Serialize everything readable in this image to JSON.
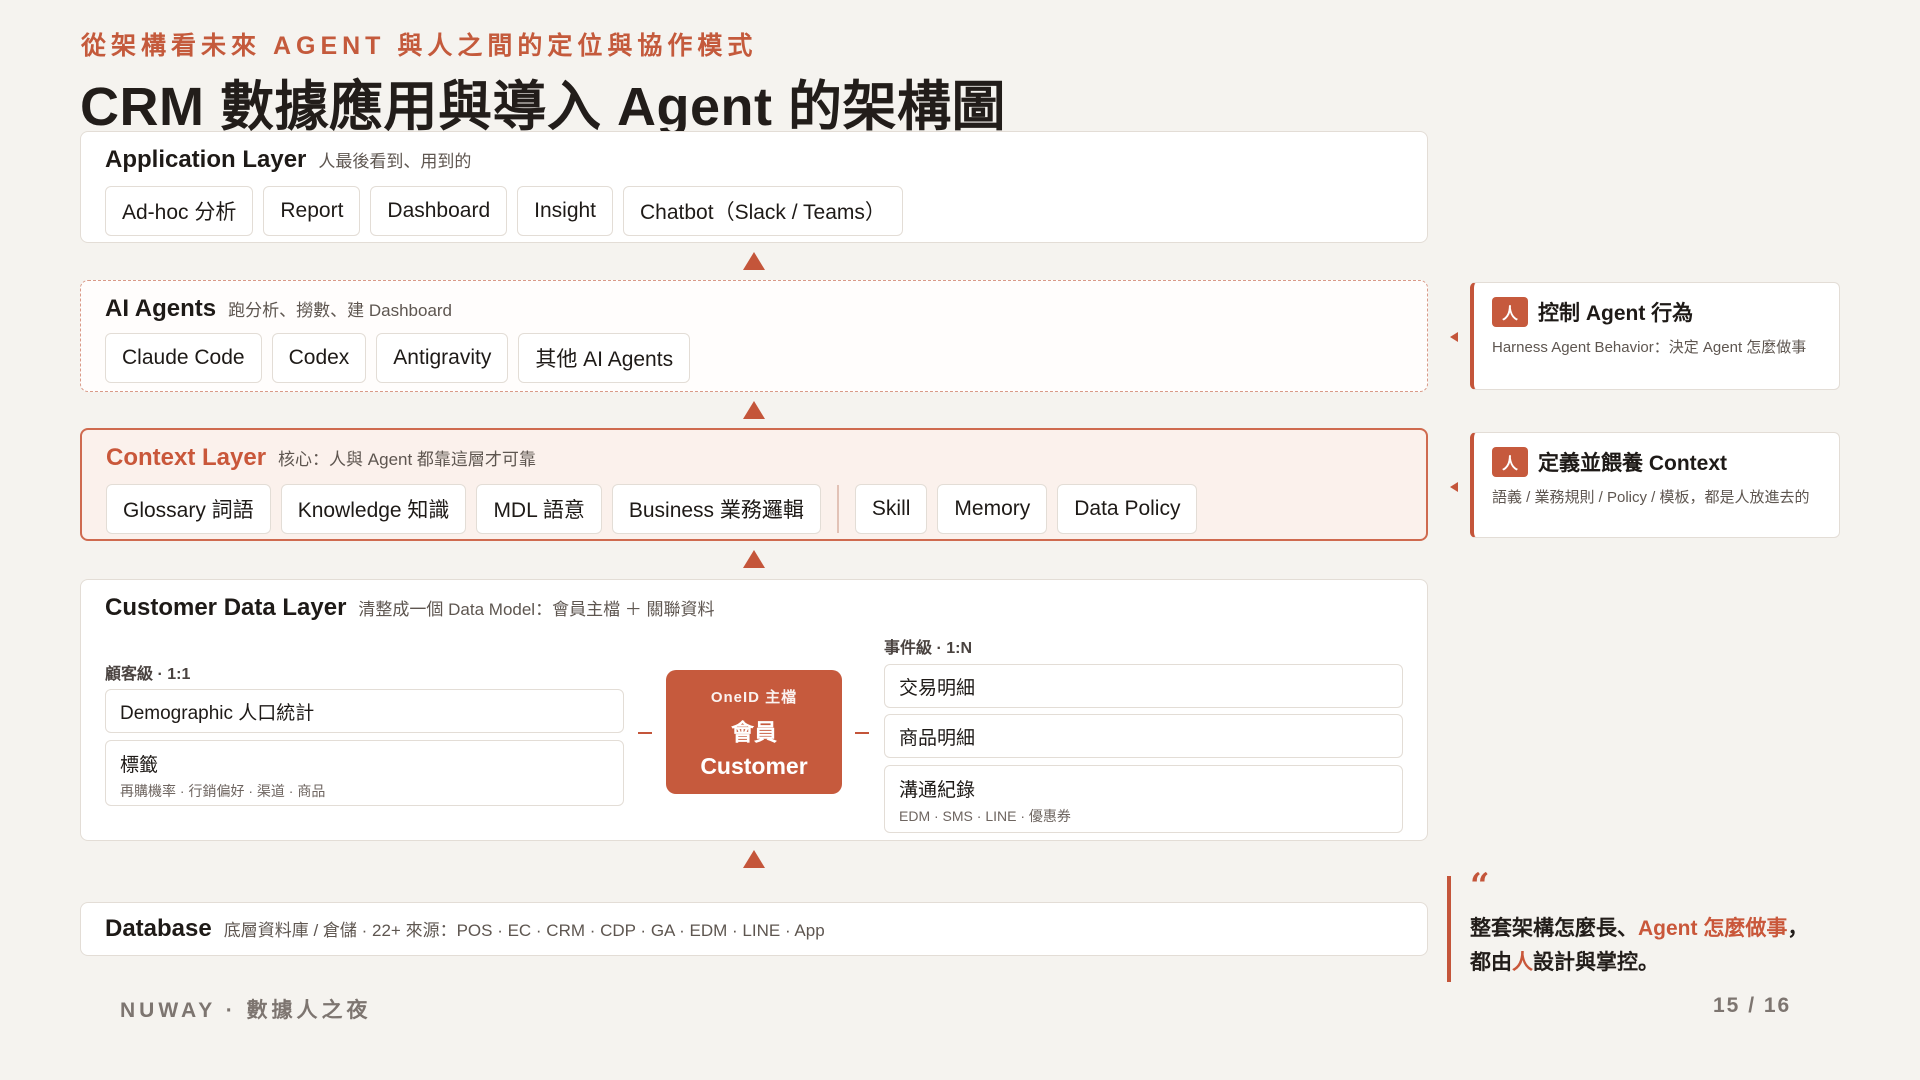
{
  "kicker": "從架構看未來 AGENT 與人之間的定位與協作模式",
  "title": "CRM 數據應用與導入 Agent 的架構圖",
  "application_layer": {
    "name": "Application Layer",
    "subtitle": "人最後看到、用到的",
    "chips": [
      "Ad-hoc 分析",
      "Report",
      "Dashboard",
      "Insight",
      "Chatbot（Slack / Teams）"
    ]
  },
  "ai_agents": {
    "name": "AI Agents",
    "subtitle": "跑分析、撈數、建 Dashboard",
    "chips": [
      "Claude Code",
      "Codex",
      "Antigravity",
      "其他 AI Agents"
    ]
  },
  "context_layer": {
    "name": "Context Layer",
    "subtitle": "核心：人與 Agent 都靠這層才可靠",
    "chips_left": [
      "Glossary 詞語",
      "Knowledge 知識",
      "MDL 語意",
      "Business 業務邏輯"
    ],
    "chips_right": [
      "Skill",
      "Memory",
      "Data Policy"
    ]
  },
  "customer_data_layer": {
    "name": "Customer Data Layer",
    "subtitle": "清整成一個 Data Model：會員主檔 ＋ 關聯資料",
    "customer_level": {
      "label": "顧客級 · 1:1",
      "items": [
        {
          "title": "Demographic 人口統計",
          "sub": ""
        },
        {
          "title": "標籤",
          "sub": "再購機率 · 行銷偏好 · 渠道 · 商品"
        }
      ]
    },
    "center": {
      "top": "OneID 主檔",
      "mid": "會員",
      "bottom": "Customer"
    },
    "event_level": {
      "label": "事件級 · 1:N",
      "items": [
        {
          "title": "交易明細",
          "sub": ""
        },
        {
          "title": "商品明細",
          "sub": ""
        },
        {
          "title": "溝通紀錄",
          "sub": "EDM · SMS · LINE · 優惠券"
        }
      ]
    }
  },
  "database": {
    "name": "Database",
    "subtitle": "底層資料庫 / 倉儲 · 22+ 來源：POS · EC · CRM · CDP · GA · EDM · LINE · App"
  },
  "side_cards": [
    {
      "badge": "人",
      "title": "控制 Agent 行為",
      "sub": "Harness Agent Behavior：決定 Agent 怎麼做事"
    },
    {
      "badge": "人",
      "title": "定義並餵養 Context",
      "sub": "語義 / 業務規則 / Policy / 模板，都是人放進去的"
    }
  ],
  "quote": {
    "mark": "“",
    "line1_a": "整套架構怎麼長、",
    "line1_b": "Agent 怎麼做事",
    "line1_c": "，",
    "line2_a": "都由",
    "line2_b": "人",
    "line2_c": "設計與掌控。"
  },
  "footer": {
    "brand": "NUWAY · 數據人之夜",
    "page": "15 / 16"
  },
  "colors": {
    "accent": "#c65a3d",
    "background": "#f5f3ef"
  }
}
